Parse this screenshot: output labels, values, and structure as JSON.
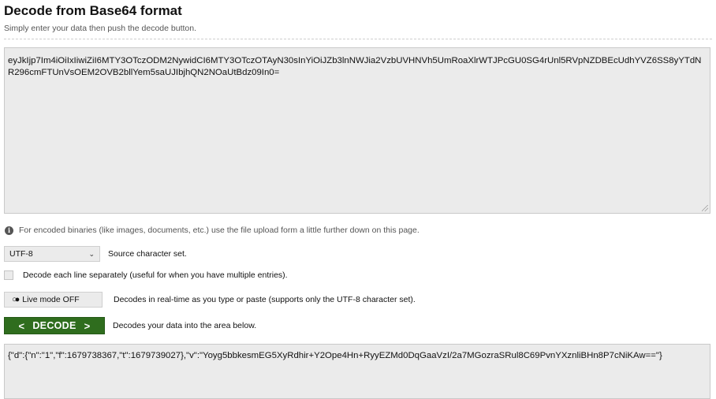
{
  "header": {
    "title": "Decode from Base64 format",
    "subtitle": "Simply enter your data then push the decode button."
  },
  "input": {
    "value": "eyJkIjp7Im4iOiIxIiwiZiI6MTY3OTczODM2NywidCI6MTY3OTczOTAyN30sInYiOiJZb3lnNWJia2VzbUVHNVh5UmRoaXlrWTJPcGU0SG4rUnl5RVpNZDBEcUdhYVZ6SS8yYTdNR296cmFTUnVsOEM2OVB2bllYem5saUJIbjhQN2NOaUtBdz09In0="
  },
  "info": {
    "icon": "info-icon",
    "text": "For encoded binaries (like images, documents, etc.) use the file upload form a little further down on this page."
  },
  "charset": {
    "selected": "UTF-8",
    "label": "Source character set."
  },
  "lines_option": {
    "checked": false,
    "label": "Decode each line separately (useful for when you have multiple entries)."
  },
  "live_mode": {
    "icon": "toggle-icon",
    "label": "Live mode OFF",
    "description": "Decodes in real-time as you type or paste (supports only the UTF-8 character set)."
  },
  "decode": {
    "label": "DECODE",
    "left_arrow": "<",
    "right_arrow": ">",
    "description": "Decodes your data into the area below.",
    "color": "#2f6d1e"
  },
  "output": {
    "value": "{\"d\":{\"n\":\"1\",\"f\":1679738367,\"t\":1679739027},\"v\":\"Yoyg5bbkesmEG5XyRdhir+Y2Ope4Hn+RyyEZMd0DqGaaVzI/2a7MGozraSRul8C69PvnYXznliBHn8P7cNiKAw==\"}"
  }
}
